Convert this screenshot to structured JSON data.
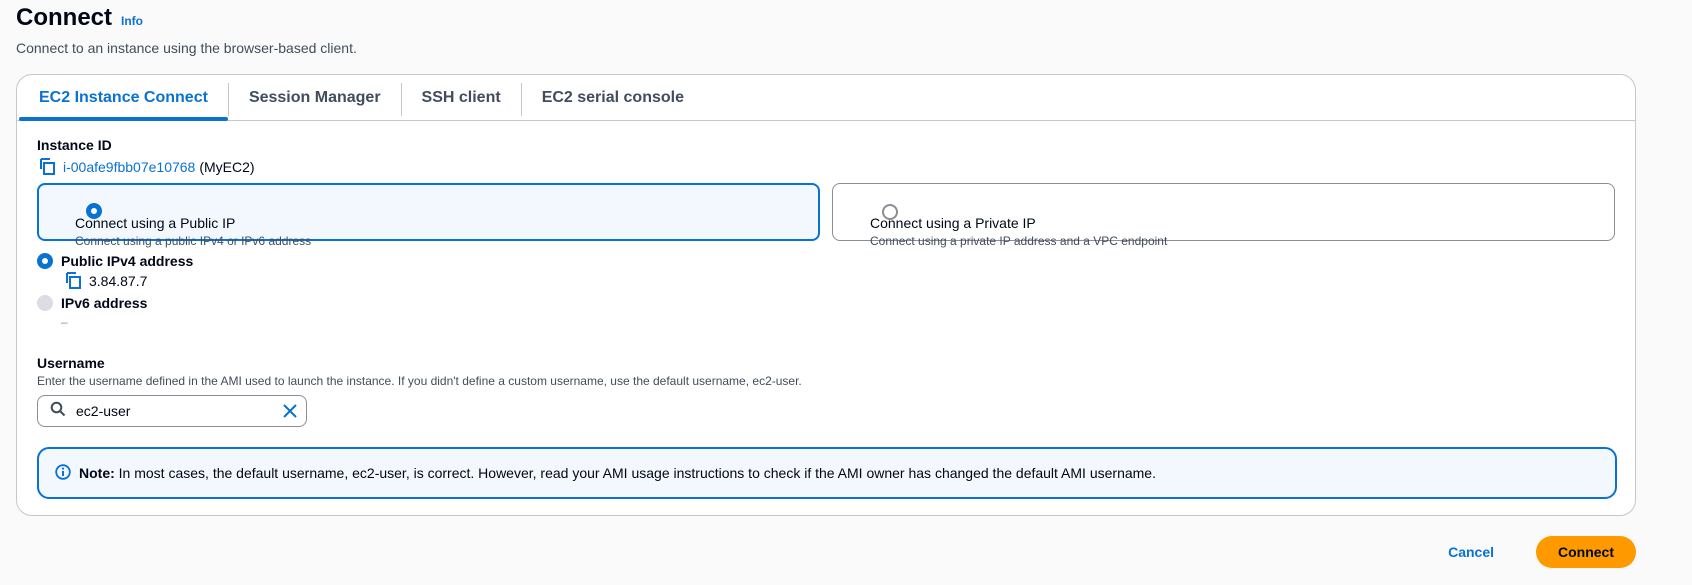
{
  "header": {
    "title": "Connect",
    "info_link": "Info",
    "subtitle": "Connect to an instance using the browser-based client."
  },
  "tabs": [
    {
      "label": "EC2 Instance Connect",
      "active": true
    },
    {
      "label": "Session Manager",
      "active": false
    },
    {
      "label": "SSH client",
      "active": false
    },
    {
      "label": "EC2 serial console",
      "active": false
    }
  ],
  "instance": {
    "label": "Instance ID",
    "id": "i-00afe9fbb07e10768",
    "name": "(MyEC2)"
  },
  "connection_type": {
    "public": {
      "title": "Connect using a Public IP",
      "description": "Connect using a public IPv4 or IPv6 address",
      "selected": true
    },
    "private": {
      "title": "Connect using a Private IP",
      "description": "Connect using a private IP address and a VPC endpoint",
      "selected": false
    }
  },
  "ip_options": {
    "ipv4": {
      "label": "Public IPv4 address",
      "value": "3.84.87.7",
      "selected": true
    },
    "ipv6": {
      "label": "IPv6 address",
      "value": "–",
      "disabled": true
    }
  },
  "username": {
    "label": "Username",
    "description": "Enter the username defined in the AMI used to launch the instance. If you didn't define a custom username, use the default username, ec2-user.",
    "value": "ec2-user"
  },
  "note": {
    "prefix": "Note:",
    "text": " In most cases, the default username, ec2-user, is correct. However, read your AMI usage instructions to check if the AMI owner has changed the default AMI username."
  },
  "actions": {
    "cancel": "Cancel",
    "connect": "Connect"
  },
  "colors": {
    "accent": "#0972d3",
    "primary_button": "#ff9900",
    "selected_tile_bg": "#f2f8fd"
  }
}
